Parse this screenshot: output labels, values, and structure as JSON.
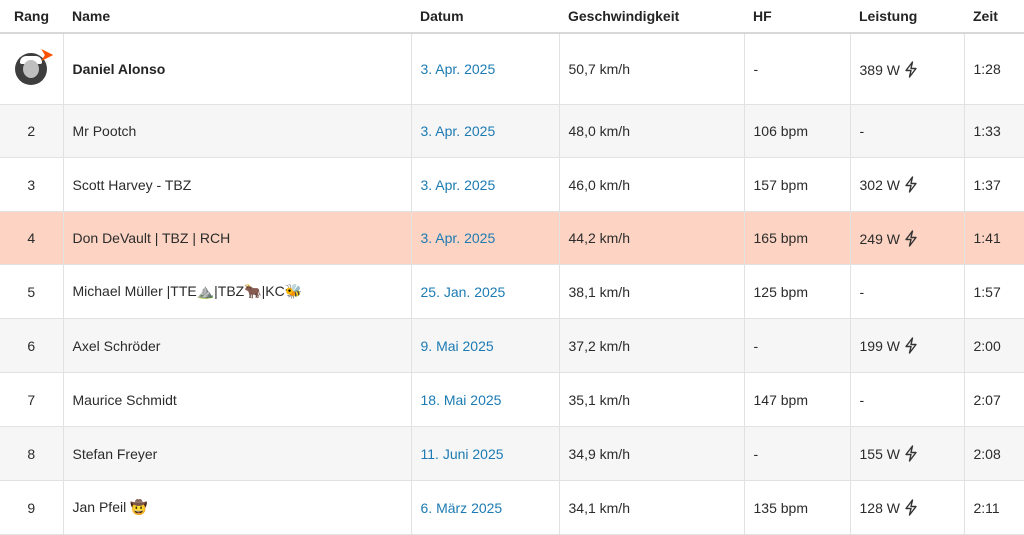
{
  "columns": {
    "rank": "Rang",
    "name": "Name",
    "date": "Datum",
    "speed": "Geschwindigkeit",
    "hr": "HF",
    "power": "Leistung",
    "time": "Zeit"
  },
  "rows": [
    {
      "rank": "",
      "name": "Daniel Alonso",
      "date": "3. Apr. 2025",
      "speed": "50,7 km/h",
      "hr": "-",
      "power": "389 W",
      "time": "1:28"
    },
    {
      "rank": "2",
      "name": "Mr Pootch",
      "date": "3. Apr. 2025",
      "speed": "48,0 km/h",
      "hr": "106 bpm",
      "power": "-",
      "time": "1:33"
    },
    {
      "rank": "3",
      "name": "Scott Harvey - TBZ",
      "date": "3. Apr. 2025",
      "speed": "46,0 km/h",
      "hr": "157 bpm",
      "power": "302 W",
      "time": "1:37"
    },
    {
      "rank": "4",
      "name": "Don DeVault | TBZ | RCH",
      "date": "3. Apr. 2025",
      "speed": "44,2 km/h",
      "hr": "165 bpm",
      "power": "249 W",
      "time": "1:41"
    },
    {
      "rank": "5",
      "name": "Michael Müller |TTE⛰️|TBZ🐂|KC🐝",
      "date": "25. Jan. 2025",
      "speed": "38,1 km/h",
      "hr": "125 bpm",
      "power": "-",
      "time": "1:57"
    },
    {
      "rank": "6",
      "name": "Axel Schröder",
      "date": "9. Mai 2025",
      "speed": "37,2 km/h",
      "hr": "-",
      "power": "199 W",
      "time": "2:00"
    },
    {
      "rank": "7",
      "name": "Maurice Schmidt",
      "date": "18. Mai 2025",
      "speed": "35,1 km/h",
      "hr": "147 bpm",
      "power": "-",
      "time": "2:07"
    },
    {
      "rank": "8",
      "name": "Stefan Freyer",
      "date": "11. Juni 2025",
      "speed": "34,9 km/h",
      "hr": "-",
      "power": "155 W",
      "time": "2:08"
    },
    {
      "rank": "9",
      "name": "Jan Pfeil 🤠",
      "date": "6. März 2025",
      "speed": "34,1 km/h",
      "hr": "135 bpm",
      "power": "128 W",
      "time": "2:11"
    }
  ],
  "highlight_row_color": "#fdd4c3",
  "date_link_color": "#1c7bb3",
  "power_icon": "lightning-bolt-icon"
}
